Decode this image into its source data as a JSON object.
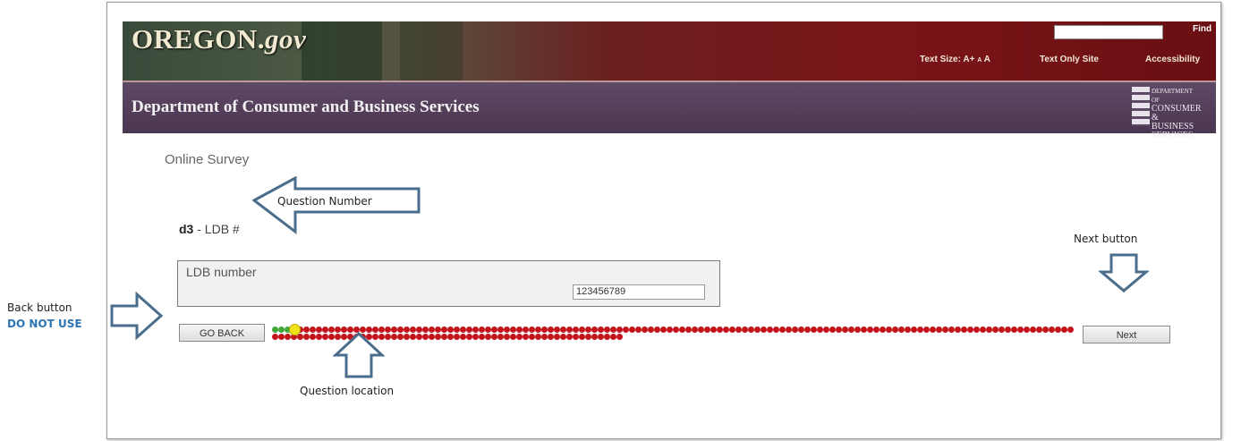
{
  "header": {
    "logo_main": "OREGON.",
    "logo_suffix": "gov",
    "find_label": "Find",
    "find_value": "",
    "text_size_label": "Text Size: A+",
    "text_size_small": "A",
    "text_size_normal": "A",
    "text_only_label": "Text Only Site",
    "accessibility_label": "Accessibility"
  },
  "department": {
    "title": "Department of Consumer and Business Services",
    "logo_lines": [
      "DEPARTMENT OF",
      "CONSUMER",
      "& BUSINESS",
      "SERVICES"
    ]
  },
  "survey": {
    "title": "Online Survey",
    "question_id": "d3",
    "question_sep": " - ",
    "question_text": "LDB #",
    "field_label": "LDB number",
    "field_value": "123456789"
  },
  "navigation": {
    "back_label": "GO BACK",
    "next_label": "Next"
  },
  "progress": {
    "answered": 3,
    "current": 4,
    "total": 184,
    "colors": {
      "answered": "#3fa63a",
      "current": "#f2e21c",
      "remaining": "#c4141b"
    }
  },
  "annotations": {
    "question_number": "Question Number",
    "next_button": "Next button",
    "back_button": "Back button",
    "back_warning": "DO NOT USE",
    "question_location": "Question location"
  },
  "colors": {
    "banner_red": "#7a1518",
    "dept_purple": "#4a3650",
    "annotation_arrow": "#4a6d8c"
  }
}
